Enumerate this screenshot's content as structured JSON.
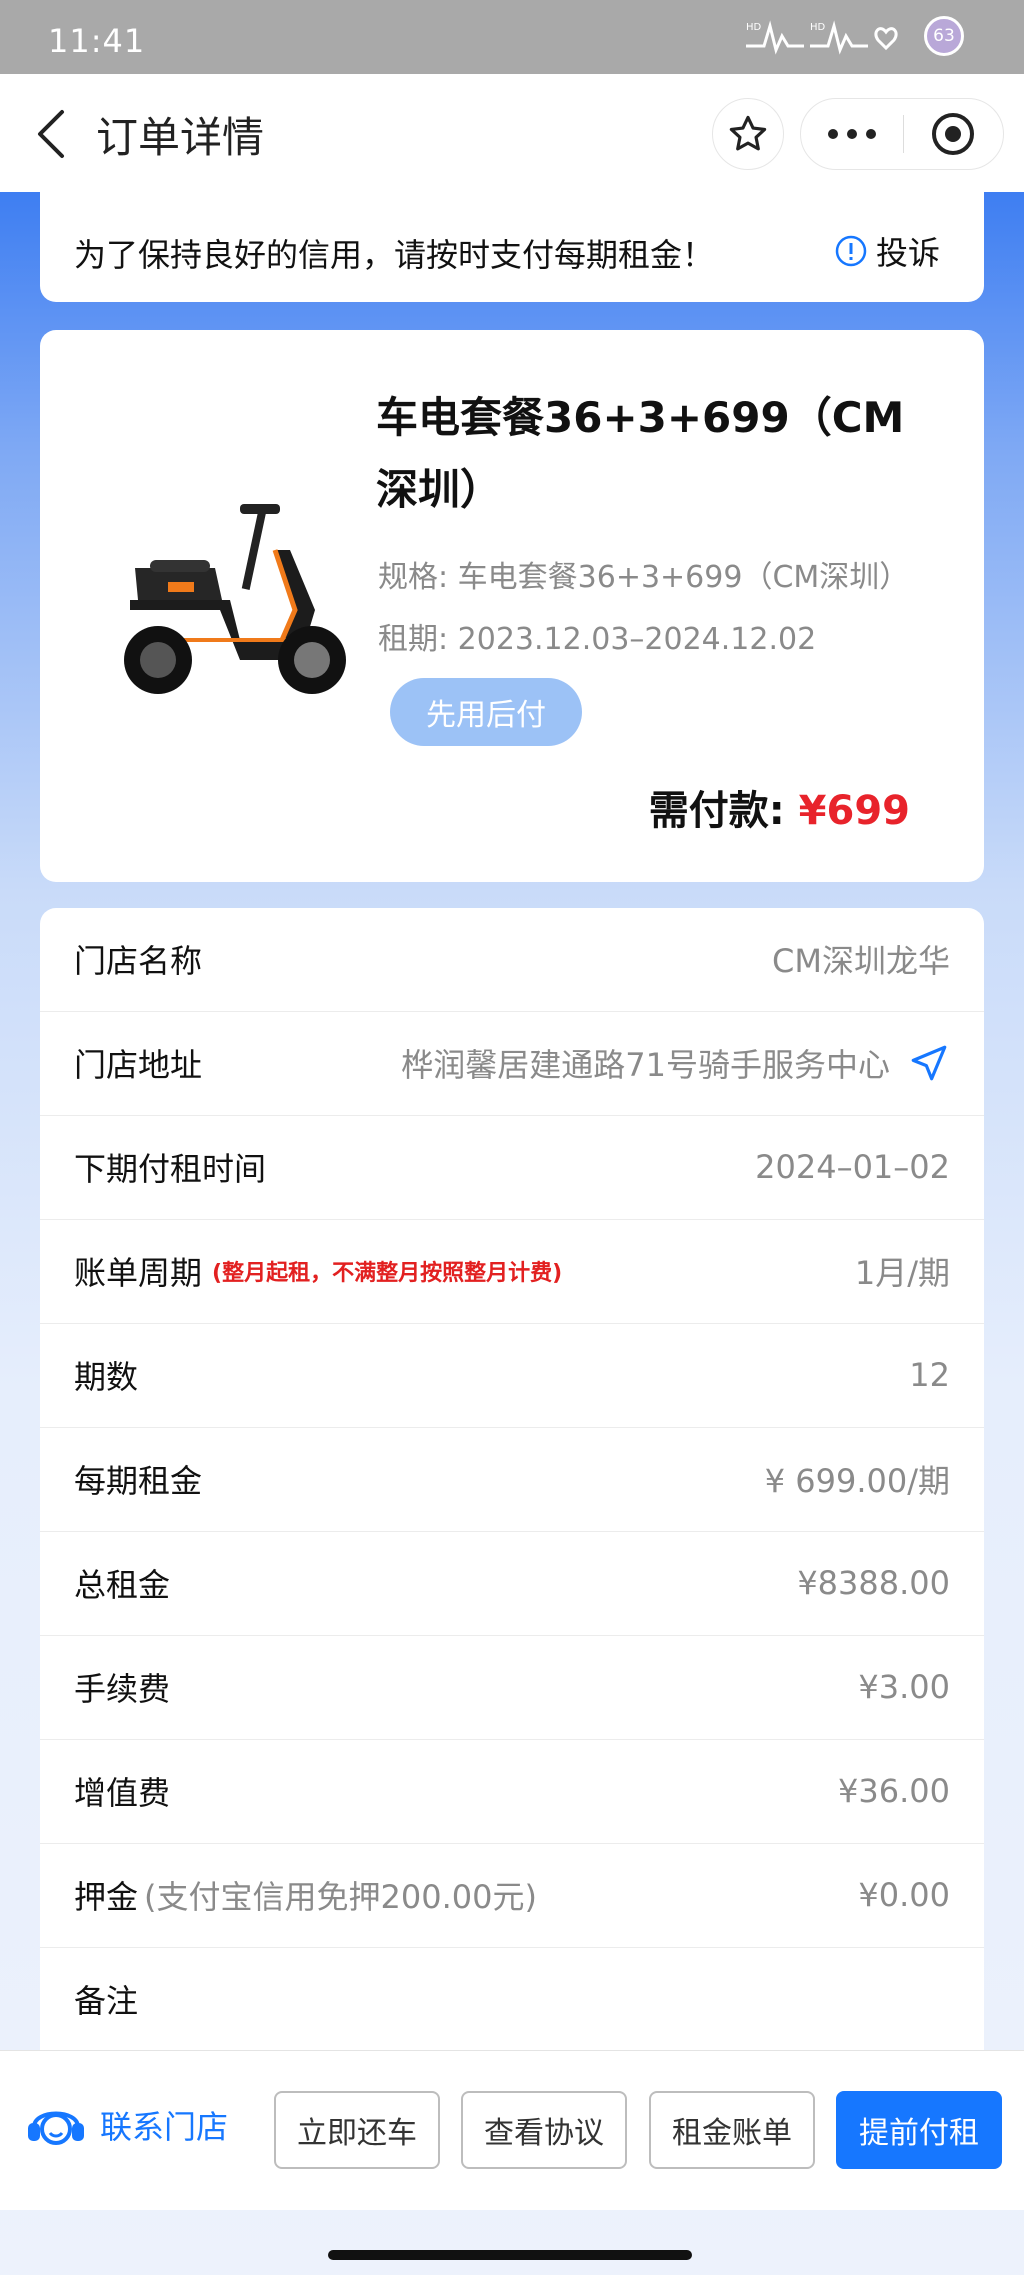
{
  "status": {
    "time": "11:41",
    "battery": "63"
  },
  "nav": {
    "title": "订单详情"
  },
  "notice": {
    "text": "为了保持良好的信用，请按时支付每期租金！",
    "complaint": "投诉"
  },
  "product": {
    "name": "车电套餐36+3+699（CM深圳）",
    "spec": "规格: 车电套餐36+3+699（CM深圳）",
    "term": "租期: 2023.12.03–2024.12.02",
    "badge": "先用后付",
    "pay_label": "需付款: ",
    "pay_amount": "¥699"
  },
  "info": {
    "store_name": {
      "label": "门店名称",
      "value": "CM深圳龙华"
    },
    "store_address": {
      "label": "门店地址",
      "value": "桦润馨居建通路71号骑手服务中心"
    },
    "next_payment": {
      "label": "下期付租时间",
      "value": "2024–01–02"
    },
    "billing_cycle": {
      "label": "账单周期",
      "note": "(整月起租，不满整月按照整月计费)",
      "value": "1月/期"
    },
    "periods": {
      "label": "期数",
      "value": "12"
    },
    "per_period_rent": {
      "label": "每期租金",
      "value": "¥ 699.00/期"
    },
    "total_rent": {
      "label": "总租金",
      "value": "¥8388.00"
    },
    "fee": {
      "label": "手续费",
      "value": "¥3.00"
    },
    "value_added": {
      "label": "增值费",
      "value": "¥36.00"
    },
    "deposit": {
      "label": "押金",
      "sub": "(支付宝信用免押200.00元)",
      "value": "¥0.00"
    },
    "remark": {
      "label": "备注",
      "value": ""
    }
  },
  "bottom": {
    "contact": "联系门店",
    "return_bike": "立即还车",
    "view_agreement": "查看协议",
    "rent_bill": "租金账单",
    "prepay": "提前付租"
  },
  "colors": {
    "accent": "#1677ff",
    "price": "#e8232b",
    "badge": "#9cc2f6"
  }
}
